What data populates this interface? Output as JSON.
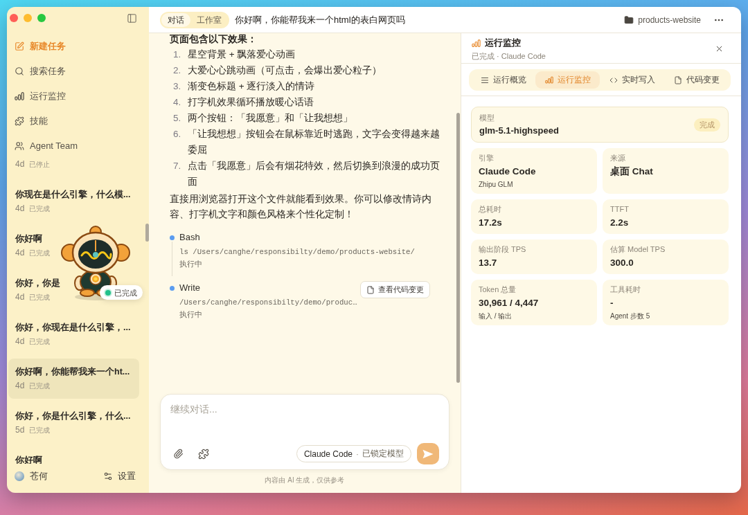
{
  "sidebar": {
    "nav": [
      {
        "kind": "primary",
        "label": "新建任务"
      },
      {
        "kind": "link",
        "label": "搜索任务"
      },
      {
        "kind": "link",
        "label": "运行监控"
      },
      {
        "kind": "link",
        "label": "技能"
      },
      {
        "kind": "link",
        "label": "Agent Team"
      }
    ],
    "tasks": [
      {
        "age": "4d",
        "status": "已停止",
        "selected": false
      },
      {
        "title": "你现在是什么引擎，什么模...",
        "age": "4d",
        "status": "已完成",
        "selected": false
      },
      {
        "title": "你好啊",
        "age": "4d",
        "status": "已完成",
        "selected": false
      },
      {
        "title": "你好，你是",
        "age": "4d",
        "status": "已完成",
        "selected": false
      },
      {
        "title": "你好，你现在是什么引擎，...",
        "age": "4d",
        "status": "已完成",
        "selected": false
      },
      {
        "title": "你好啊，你能帮我来一个ht...",
        "age": "4d",
        "status": "已完成",
        "selected": true
      },
      {
        "title": "你好，你是什么引擎，什么...",
        "age": "5d",
        "status": "已完成",
        "selected": false
      },
      {
        "title": "你好啊",
        "selected": false
      }
    ],
    "mascot": {
      "status": "已完成"
    },
    "user": {
      "name": "苍何"
    },
    "settings": {
      "label": "设置"
    }
  },
  "top_bar": {
    "mode_tabs": [
      {
        "label": "对话",
        "selected": true
      },
      {
        "label": "工作室",
        "selected": false
      }
    ],
    "title": "你好啊，你能帮我来一个html的表白网页吗",
    "project": "products-website"
  },
  "chat": {
    "heading": "页面包含以下效果：",
    "list": [
      {
        "number": "1.",
        "text": "星空背景 + 飘落爱心动画"
      },
      {
        "number": "2.",
        "text": "大爱心心跳动画（可点击，会爆出爱心粒子）"
      },
      {
        "number": "3.",
        "text": "渐变色标题 + 逐行淡入的情诗"
      },
      {
        "number": "4.",
        "text": "打字机效果循环播放暖心话语"
      },
      {
        "number": "5.",
        "text": "两个按钮：「我愿意」和「让我想想」"
      },
      {
        "number": "6.",
        "text": "「让我想想」按钮会在鼠标靠近时逃跑，文字会变得越来越委屈"
      },
      {
        "number": "7.",
        "text": "点击「我愿意」后会有烟花特效，然后切换到浪漫的成功页面"
      }
    ],
    "paragraph": "直接用浏览器打开这个文件就能看到效果。你可以修改情诗内容、打字机文字和颜色风格来个性化定制！",
    "steps": [
      {
        "tool": "Bash",
        "detail": "ls /Users/canghe/responsibilty/demo/products-website/",
        "status": "执行中"
      },
      {
        "tool": "Write",
        "detail": "/Users/canghe/responsibilty/demo/produc…",
        "status": "执行中",
        "action": "查看代码变更"
      }
    ],
    "input": {
      "placeholder": "继续对话..."
    },
    "engine": {
      "name": "Claude Code",
      "separator": "·",
      "note": "已锁定模型"
    },
    "disclaimer": "内容由 AI 生成，仅供参考"
  },
  "monitor": {
    "title": "运行监控",
    "subtitle": "已完成 · Claude Code",
    "tabs": [
      {
        "label": "运行概览",
        "selected": false
      },
      {
        "label": "运行监控",
        "selected": true
      },
      {
        "label": "实时写入",
        "selected": false
      },
      {
        "label": "代码变更",
        "selected": false
      }
    ],
    "model": {
      "label": "模型",
      "value": "glm-5.1-highspeed",
      "badge": "完成"
    },
    "metrics": [
      {
        "label": "引擎",
        "value": "Claude Code",
        "note": "Zhipu GLM"
      },
      {
        "label": "来源",
        "value": "桌面 Chat"
      },
      {
        "label": "总耗时",
        "value": "17.2s"
      },
      {
        "label": "TTFT",
        "value": "2.2s"
      },
      {
        "label": "输出阶段 TPS",
        "value": "13.7"
      },
      {
        "label": "估算 Model TPS",
        "value": "300.0"
      },
      {
        "label": "Token 总量",
        "value": "30,961 / 4,447",
        "note": "输入 / 输出"
      },
      {
        "label": "工具耗时",
        "value": "-",
        "note": "Agent 步数 5"
      }
    ]
  }
}
